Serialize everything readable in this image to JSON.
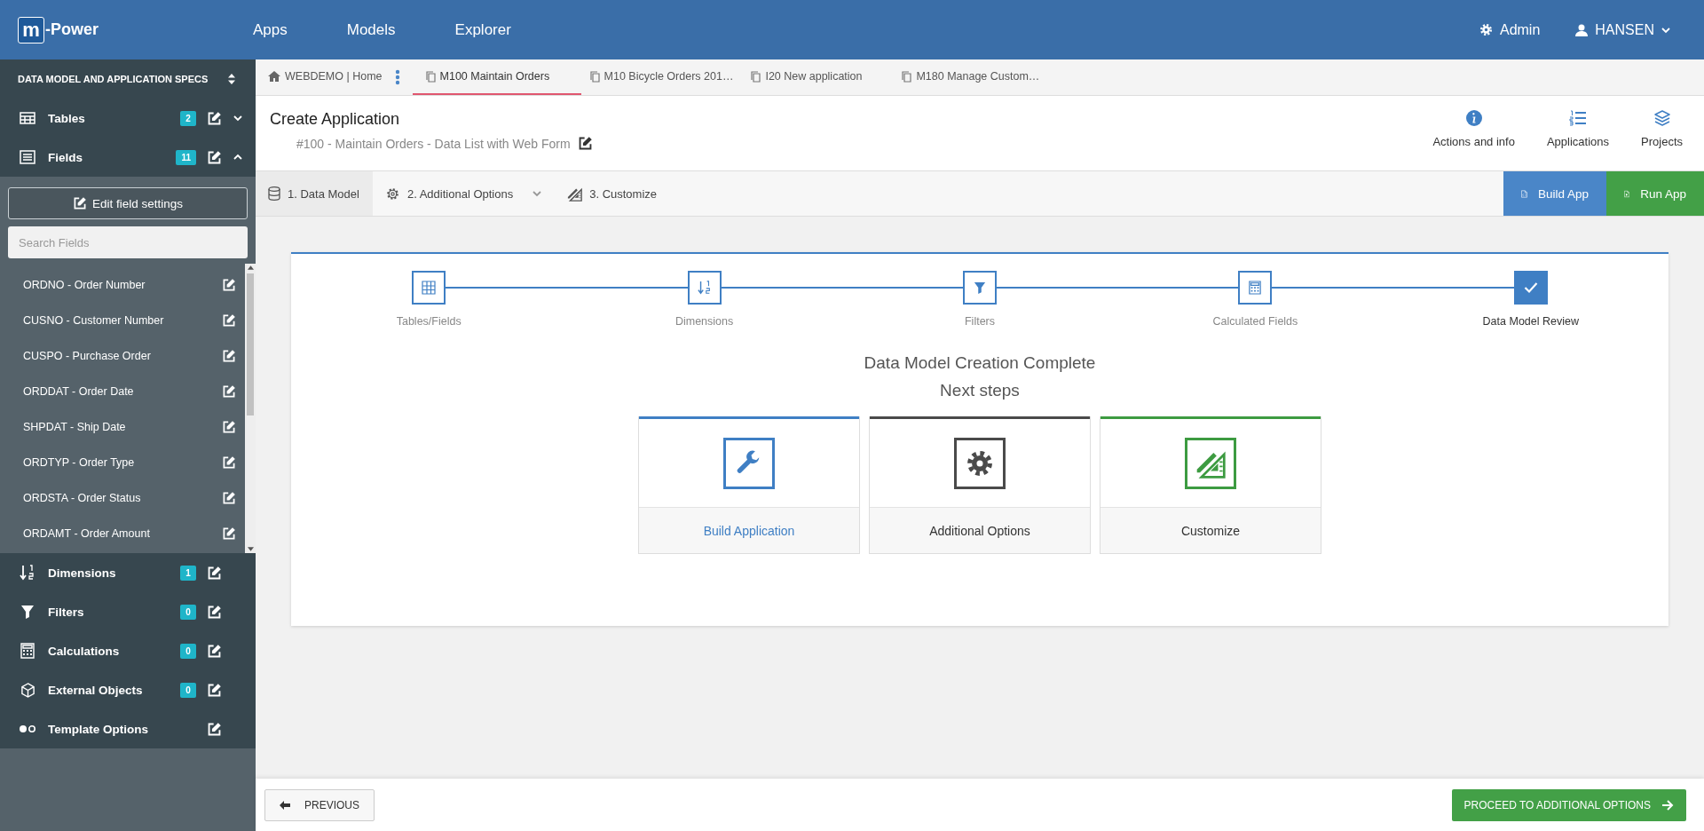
{
  "brand": {
    "logo_letter": "m",
    "name": "-Power"
  },
  "nav": [
    {
      "label": "Apps"
    },
    {
      "label": "Models"
    },
    {
      "label": "Explorer"
    }
  ],
  "user_menu": {
    "admin": "Admin",
    "user": "HANSEN"
  },
  "sidebar": {
    "title": "DATA MODEL AND APPLICATION SPECS",
    "sections": [
      {
        "kind": "tables",
        "label": "Tables",
        "count": "2",
        "expanded": false
      },
      {
        "kind": "fields",
        "label": "Fields",
        "count": "11",
        "expanded": true
      }
    ],
    "edit_button": "Edit field settings",
    "search": {
      "placeholder": "Search Fields"
    },
    "fields": [
      {
        "label": "ORDNO - Order Number"
      },
      {
        "label": "CUSNO - Customer Number"
      },
      {
        "label": "CUSPO - Purchase Order"
      },
      {
        "label": "ORDDAT - Order Date"
      },
      {
        "label": "SHPDAT - Ship Date"
      },
      {
        "label": "ORDTYP - Order Type"
      },
      {
        "label": "ORDSTA - Order Status"
      },
      {
        "label": "ORDAMT - Order Amount"
      }
    ],
    "more_sections": [
      {
        "kind": "dimensions",
        "label": "Dimensions",
        "count": "1"
      },
      {
        "kind": "filters",
        "label": "Filters",
        "count": "0"
      },
      {
        "kind": "calculations",
        "label": "Calculations",
        "count": "0"
      },
      {
        "kind": "external",
        "label": "External Objects",
        "count": "0"
      },
      {
        "kind": "template",
        "label": "Template Options"
      }
    ]
  },
  "tabs": [
    {
      "kind": "home",
      "label": "WEBDEMO | Home",
      "selected": false
    },
    {
      "kind": "document",
      "label": "M100 Maintain Orders",
      "selected": true
    },
    {
      "kind": "document",
      "label": "M10 Bicycle Orders 201…",
      "selected": false
    },
    {
      "kind": "document",
      "label": "I20 New application",
      "selected": false
    },
    {
      "kind": "document",
      "label": "M180 Manage Custom…",
      "selected": false
    }
  ],
  "header": {
    "title": "Create Application",
    "subtitle": "#100 - Maintain Orders - Data List with Web Form",
    "actions": [
      {
        "kind": "info",
        "label": "Actions and info"
      },
      {
        "kind": "list",
        "label": "Applications"
      },
      {
        "kind": "layers",
        "label": "Projects"
      }
    ]
  },
  "work_steps": [
    {
      "kind": "database",
      "label": "1. Data Model",
      "selected": true,
      "dropdown": false
    },
    {
      "kind": "gear",
      "label": "2. Additional Options",
      "selected": false,
      "dropdown": true
    },
    {
      "kind": "ruler",
      "label": "3. Customize",
      "selected": false,
      "dropdown": false
    }
  ],
  "build_button": "Build App",
  "run_button": "Run App",
  "stepper": [
    {
      "kind": "grid",
      "label": "Tables/Fields",
      "done": false
    },
    {
      "kind": "sort",
      "label": "Dimensions",
      "done": false
    },
    {
      "kind": "filter",
      "label": "Filters",
      "done": false
    },
    {
      "kind": "calculator",
      "label": "Calculated Fields",
      "done": false
    },
    {
      "kind": "check",
      "label": "Data Model Review",
      "done": true
    }
  ],
  "completion": {
    "title": "Data Model Creation Complete",
    "subtitle": "Next steps"
  },
  "cards": [
    {
      "kind": "wrench",
      "label": "Build Application",
      "color": "#3f7fc4",
      "primary": true
    },
    {
      "kind": "gear",
      "label": "Additional Options",
      "color": "#4a4a4a",
      "primary": false
    },
    {
      "kind": "ruler",
      "label": "Customize",
      "color": "#3d9b41",
      "primary": false
    }
  ],
  "footer": {
    "previous": "PREVIOUS",
    "proceed": "PROCEED TO ADDITIONAL OPTIONS"
  }
}
